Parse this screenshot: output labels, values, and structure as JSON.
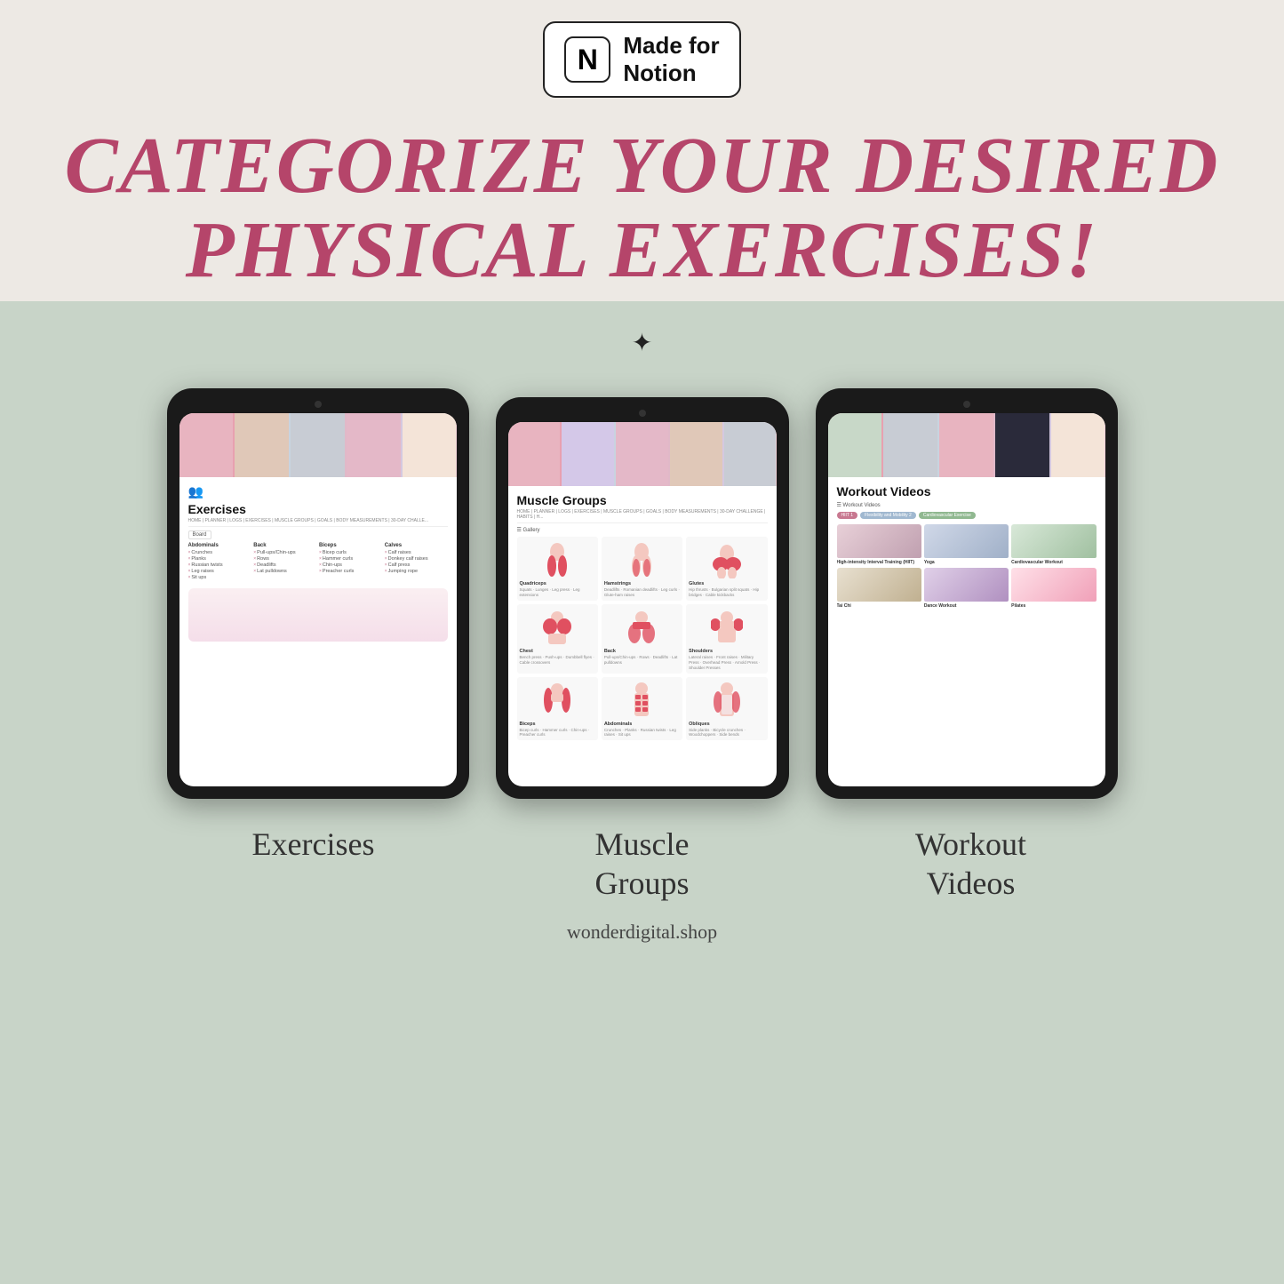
{
  "badge": {
    "icon": "N",
    "line1": "Made for",
    "line2": "Notion"
  },
  "headline": {
    "line1": "Categorize Your Desired",
    "line2": "Physical Exercises!"
  },
  "sparkle": "✦",
  "tablets": [
    {
      "id": "exercises",
      "label": "Exercises",
      "screen": {
        "nav": "HOME | PLANNER | LOGS | EXERCISES | MUSCLE GROUPS | GOALS | BODY MEASUREMENTS | 30-DAY CHALLE...",
        "title": "Exercises",
        "boardLabel": "Board",
        "columns": [
          {
            "header": "Abdominals",
            "items": [
              "Crunches",
              "Planks",
              "Russian twists",
              "Leg raises",
              "Sit ups"
            ]
          },
          {
            "header": "Back",
            "items": [
              "Pull-ups/Chin-ups",
              "Rows",
              "Deadlifts",
              "Lat pulldowns"
            ]
          },
          {
            "header": "Biceps",
            "items": [
              "Bicep curls",
              "Hammer curls",
              "Chin-ups",
              "Preacher curls"
            ]
          },
          {
            "header": "Calves",
            "items": [
              "Calf raises",
              "Donkey calf raises",
              "Calf press",
              "Jumping rope"
            ]
          }
        ]
      }
    },
    {
      "id": "muscle-groups",
      "label": "Muscle\nGroups",
      "screen": {
        "nav": "HOME | PLANNER | LOGS | EXERCISES | MUSCLE GROUPS | GOALS | BODY MEASUREMENTS | 30-DAY CHALLENGE | HABITS | H...",
        "title": "Muscle Groups",
        "galleryLabel": "Gallery",
        "cards": [
          {
            "name": "Quadriceps",
            "exercises": "Squats · Lunges · Leg press\nLeg extensions",
            "color": "#f4c8c8"
          },
          {
            "name": "Hamstrings",
            "exercises": "Deadlifts · Romanian deadlifts\nLeg curls · Glute-ham raises",
            "color": "#f4c8c8"
          },
          {
            "name": "Glutes",
            "exercises": "Hip thrusts · Bulgarian split squats\nHip bridges · Cable kickbacks",
            "color": "#f4c8c8"
          },
          {
            "name": "Chest",
            "exercises": "Bench press · Push-ups\nDumbbell flyes · Cable crossovers",
            "color": "#f4c8c8"
          },
          {
            "name": "Back",
            "exercises": "Pull-ups/Chin-ups · Rows · Deadlifts\nLat pulldowns",
            "color": "#f4c8c8"
          },
          {
            "name": "Shoulders",
            "exercises": "Lateral raises · Front raises\nMilitary Press · Overhead Press\nArnold Press · Shoulder Presses",
            "color": "#f4c8c8"
          },
          {
            "name": "Biceps",
            "exercises": "Bicep curls · Hammer curls · Chin-ups\nPreacher curls",
            "color": "#f4c8c8"
          },
          {
            "name": "Abdominals",
            "exercises": "Crunches · Planks · Russian twists\nLeg raises · Sit ups",
            "color": "#f4c8c8"
          },
          {
            "name": "Obliques",
            "exercises": "Side planks · Bicycle crunches\nWoodchoppers · Side bends",
            "color": "#f4c8c8"
          }
        ]
      }
    },
    {
      "id": "workout-videos",
      "label": "Workout\nVideos",
      "screen": {
        "nav": "",
        "title": "Workout Videos",
        "sectionLabel": "Workout Videos",
        "tags": [
          "HIIT",
          "Flexibility and Mobility",
          "Cardiovascular Exercise"
        ],
        "videos": [
          {
            "name": "High-Intensity Interval Training (HIIT)",
            "thumbColor": "#e8d0d8",
            "category": "hiit"
          },
          {
            "name": "Yoga",
            "thumbColor": "#d0d8e8",
            "category": "yoga"
          },
          {
            "name": "Cardiovascular Workout",
            "thumbColor": "#d8e8d8",
            "category": "cardio"
          },
          {
            "name": "Tai Chi",
            "thumbColor": "#e8e0d0",
            "category": "tachi"
          },
          {
            "name": "Dance Workout",
            "thumbColor": "#e0d0e8",
            "category": "dance"
          },
          {
            "name": "Pilates",
            "thumbColor": "#ffe0e8",
            "category": "pilates"
          }
        ]
      }
    }
  ],
  "footer": {
    "website": "wonderdigital.shop"
  }
}
